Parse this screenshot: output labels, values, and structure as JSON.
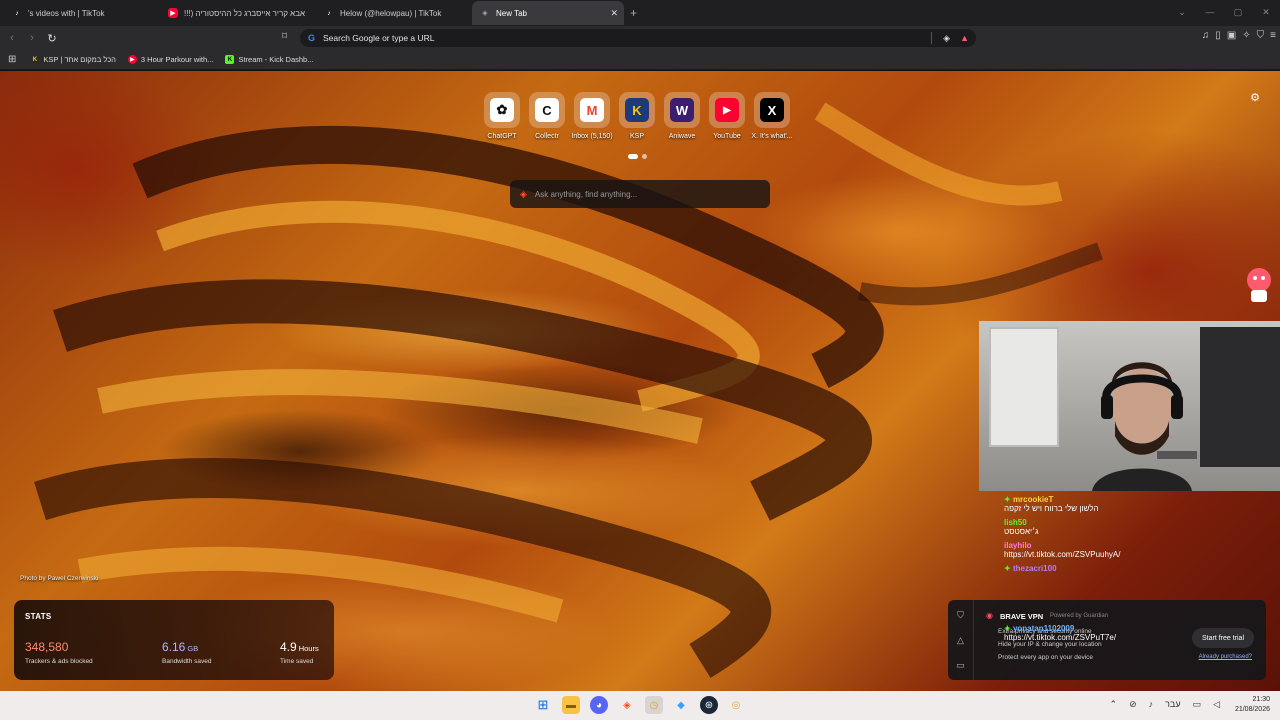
{
  "tabs": [
    {
      "title": "'s videos with | TikTok",
      "favicon": "tiktok-icon",
      "color": "#ffffff"
    },
    {
      "title": "אבא קריר אייסברג כל ההיסטוריה (!!!",
      "favicon": "youtube-icon",
      "color": "#ff0033"
    },
    {
      "title": "Helow (@helowpau) | TikTok",
      "favicon": "tiktok-icon",
      "color": "#ffffff"
    },
    {
      "title": "New Tab",
      "favicon": "brave-icon",
      "color": "#aaaaaa",
      "active": true
    }
  ],
  "omnibox": {
    "placeholder": "Search Google or type a URL"
  },
  "bookmarks": [
    {
      "label": "KSP | הכל במקום אחד",
      "icon": "ksp-icon",
      "color": "#f5c518"
    },
    {
      "label": "3 Hour Parkour with...",
      "icon": "youtube-icon",
      "color": "#ff0033"
    },
    {
      "label": "Stream - Kick Dashb...",
      "icon": "kick-icon",
      "color": "#53fc18"
    }
  ],
  "top_sites": [
    {
      "label": "ChatGPT",
      "glyph": "✿",
      "bg": "#ffffff",
      "fg": "#111111"
    },
    {
      "label": "Collectr",
      "glyph": "C",
      "bg": "#ffffff",
      "fg": "#111111"
    },
    {
      "label": "Inbox (5,150)",
      "glyph": "M",
      "bg": "#ffffff",
      "fg": "#ea4335"
    },
    {
      "label": "KSP",
      "glyph": "K",
      "bg": "#1f3a7a",
      "fg": "#f5c518"
    },
    {
      "label": "Aniwave",
      "glyph": "W",
      "bg": "#3b1f6e",
      "fg": "#ffffff"
    },
    {
      "label": "YouTube",
      "glyph": "▶",
      "bg": "#ff0033",
      "fg": "#ffffff"
    },
    {
      "label": "X. It's what'...",
      "glyph": "X",
      "bg": "#000000",
      "fg": "#ffffff"
    }
  ],
  "search_box": {
    "placeholder": "Ask anything, find anything..."
  },
  "photo_credit": "Photo by Pawel Czerwinski",
  "stats": {
    "title": "STATS",
    "items": [
      {
        "value": "348,580",
        "unit": "",
        "caption": "Trackers & ads blocked",
        "color": "#ff8a6b"
      },
      {
        "value": "6.16",
        "unit": "GB",
        "caption": "Bandwidth saved",
        "color": "#a9b7ff"
      },
      {
        "value": "4.9",
        "unit": "Hours",
        "caption": "Time saved",
        "color": "#ffffff"
      }
    ]
  },
  "chat": [
    {
      "user": "mrcookieT",
      "color": "#ffd23f",
      "text": "הלשון שלי ברווח ויש לי זקפה",
      "badge": true
    },
    {
      "user": "lish50",
      "color": "#53fc18",
      "text": "ג׳יאסטסט",
      "badge": false
    },
    {
      "user": "ilayhilo",
      "color": "#ff7ad9",
      "text": "https://vt.tiktok.com/ZSVPuuhyA/",
      "badge": false
    },
    {
      "user": "thezacri100",
      "color": "#b57bff",
      "text": "",
      "badge": true
    },
    {
      "user": "yonatan1102009",
      "color": "#6fb6ff",
      "text": "https://vt.tiktok.com/ZSVPuT7e/",
      "badge": true
    }
  ],
  "vpn": {
    "brand": "BRAVE VPN",
    "powered": "Powered by Guardian",
    "line1": "Extra privacy and security online",
    "line2": "Hide your IP & change your location",
    "line3": "Protect every app on your device",
    "trial": "Start free trial",
    "purchased": "Already purchased?"
  },
  "clock": {
    "time": "21:30",
    "date": "21/08/2026"
  },
  "tray_lang": "עבר"
}
